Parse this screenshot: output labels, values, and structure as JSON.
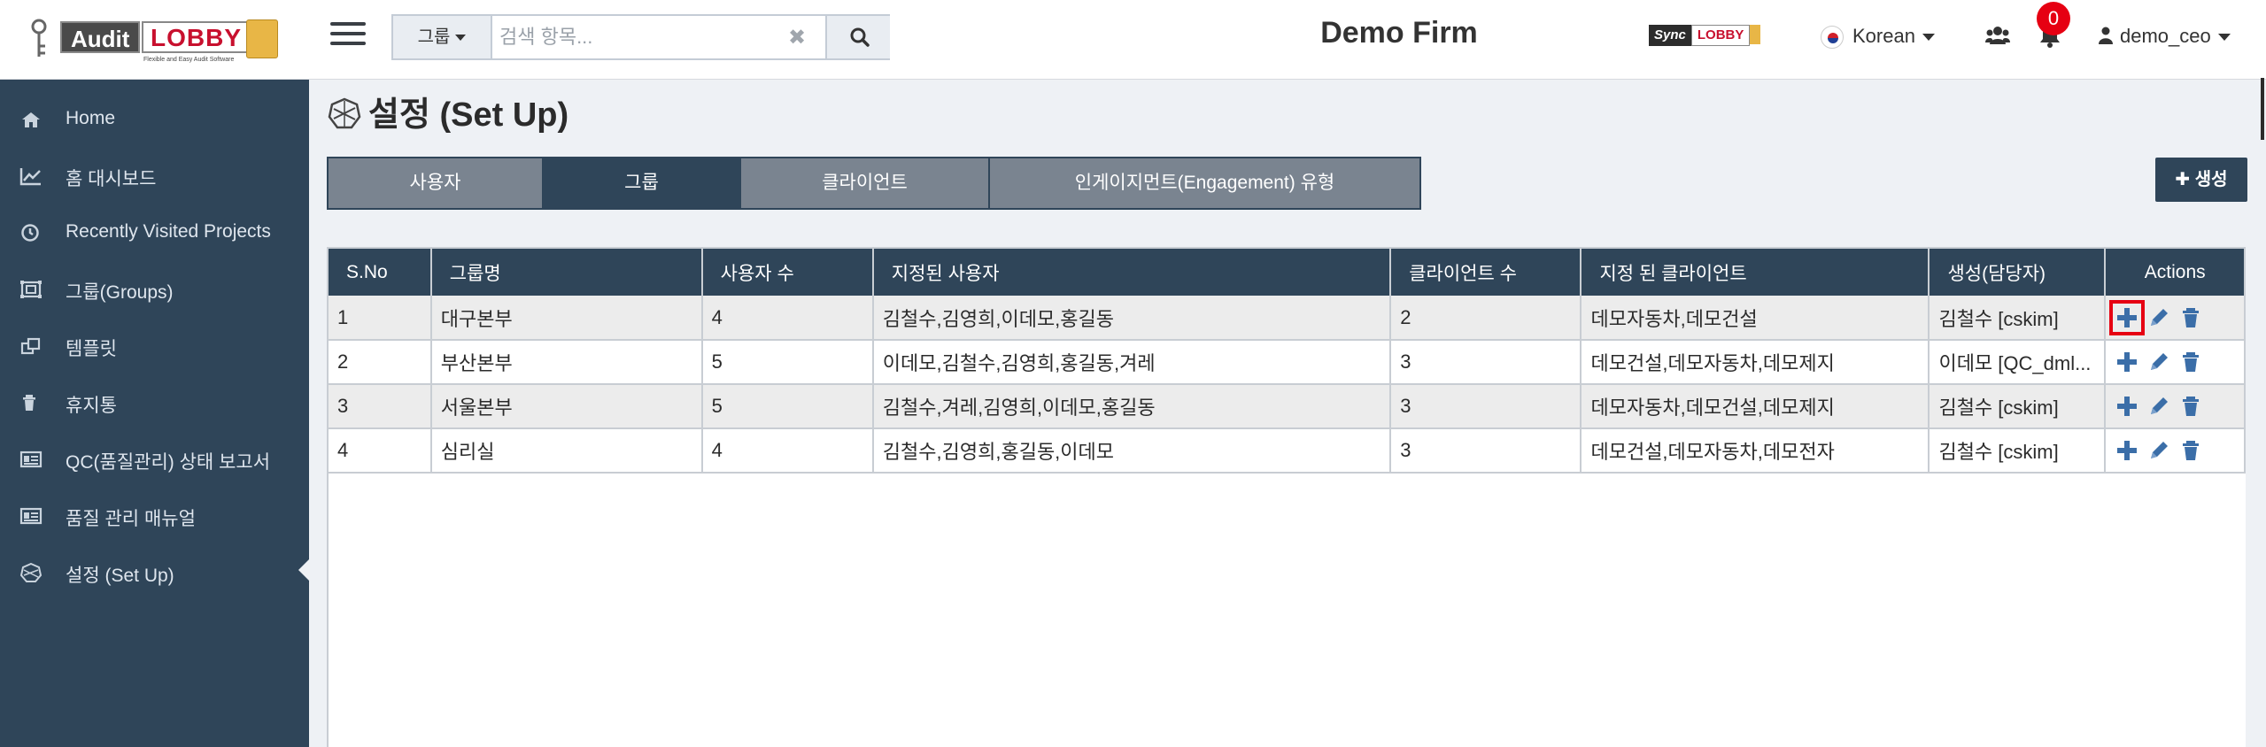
{
  "app": {
    "logo_left": "Audit",
    "logo_right": "LOBBY",
    "logo_tagline": "Flexible and Easy Audit Software",
    "firm_name": "Demo Firm",
    "sync_left": "Sync",
    "sync_right": "LOBBY"
  },
  "search": {
    "scope": "그룹",
    "placeholder": "검색 항목..."
  },
  "header": {
    "language": "Korean",
    "notifications_count": "0",
    "user": "demo_ceo"
  },
  "sidebar": {
    "items": [
      {
        "label": "Home",
        "icon": "home-icon"
      },
      {
        "label": "홈 대시보드",
        "icon": "line-chart-icon"
      },
      {
        "label": "Recently Visited Projects",
        "icon": "clock-icon"
      },
      {
        "label": "그룹(Groups)",
        "icon": "groups-icon"
      },
      {
        "label": "템플릿",
        "icon": "template-icon"
      },
      {
        "label": "휴지통",
        "icon": "trash-icon"
      },
      {
        "label": "QC(품질관리) 상태 보고서",
        "icon": "report-icon"
      },
      {
        "label": "품질 관리 매뉴얼",
        "icon": "manual-icon"
      },
      {
        "label": "설정 (Set Up)",
        "icon": "setup-icon"
      }
    ],
    "active_index": 8
  },
  "page": {
    "title": "설정 (Set Up)",
    "create_label": "생성"
  },
  "tabs": [
    {
      "label": "사용자",
      "active": false
    },
    {
      "label": "그룹",
      "active": true
    },
    {
      "label": "클라이언트",
      "active": false
    },
    {
      "label": "인게이지먼트(Engagement) 유형",
      "active": false
    }
  ],
  "table": {
    "headers": [
      "S.No",
      "그룹명",
      "사용자 수",
      "지정된 사용자",
      "클라이언트 수",
      "지정 된 클라이언트",
      "생성(담당자)",
      "Actions"
    ],
    "rows": [
      [
        "1",
        "대구본부",
        "4",
        "김철수,김영희,이데모,홍길동",
        "2",
        "데모자동차,데모건설",
        "김철수 [cskim]"
      ],
      [
        "2",
        "부산본부",
        "5",
        "이데모,김철수,김영희,홍길동,겨레",
        "3",
        "데모건설,데모자동차,데모제지",
        "이데모 [QC_dml..."
      ],
      [
        "3",
        "서울본부",
        "5",
        "김철수,겨레,김영희,이데모,홍길동",
        "3",
        "데모자동차,데모건설,데모제지",
        "김철수 [cskim]"
      ],
      [
        "4",
        "심리실",
        "4",
        "김철수,김영희,홍길동,이데모",
        "3",
        "데모건설,데모자동차,데모전자",
        "김철수 [cskim]"
      ]
    ],
    "highlighted_action": {
      "row": 0,
      "action": "add"
    }
  },
  "colors": {
    "sidebar_bg": "#2f4559",
    "accent": "#2f4559",
    "tab_inactive": "#7a8490",
    "highlight": "#e60012",
    "action_icon": "#3b6ea8"
  }
}
